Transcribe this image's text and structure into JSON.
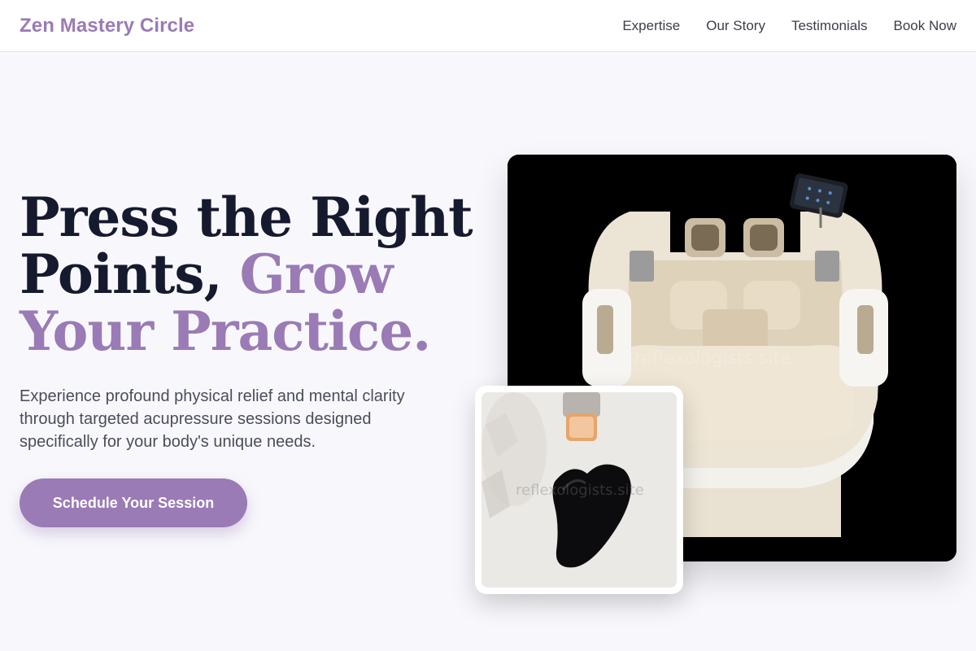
{
  "header": {
    "brand": "Zen Mastery Circle",
    "nav": [
      {
        "label": "Expertise"
      },
      {
        "label": "Our Story"
      },
      {
        "label": "Testimonials"
      },
      {
        "label": "Book Now"
      }
    ]
  },
  "hero": {
    "title_line1": "Press the Right",
    "title_line2_plain": "Points, ",
    "title_line2_accent": "Grow",
    "title_line3_accent": "Your Practice.",
    "description": "Experience profound physical relief and mental clarity through targeted acupressure sessions designed specifically for your body's unique needs.",
    "cta_label": "Schedule Your Session"
  },
  "images": {
    "main_alt": "massage chair",
    "inset_alt": "gua sha stone with serum",
    "watermark": "reflexologists.site"
  },
  "colors": {
    "accent": "#9a7bb5",
    "heading": "#161a2e",
    "background": "#f8f8fc"
  }
}
